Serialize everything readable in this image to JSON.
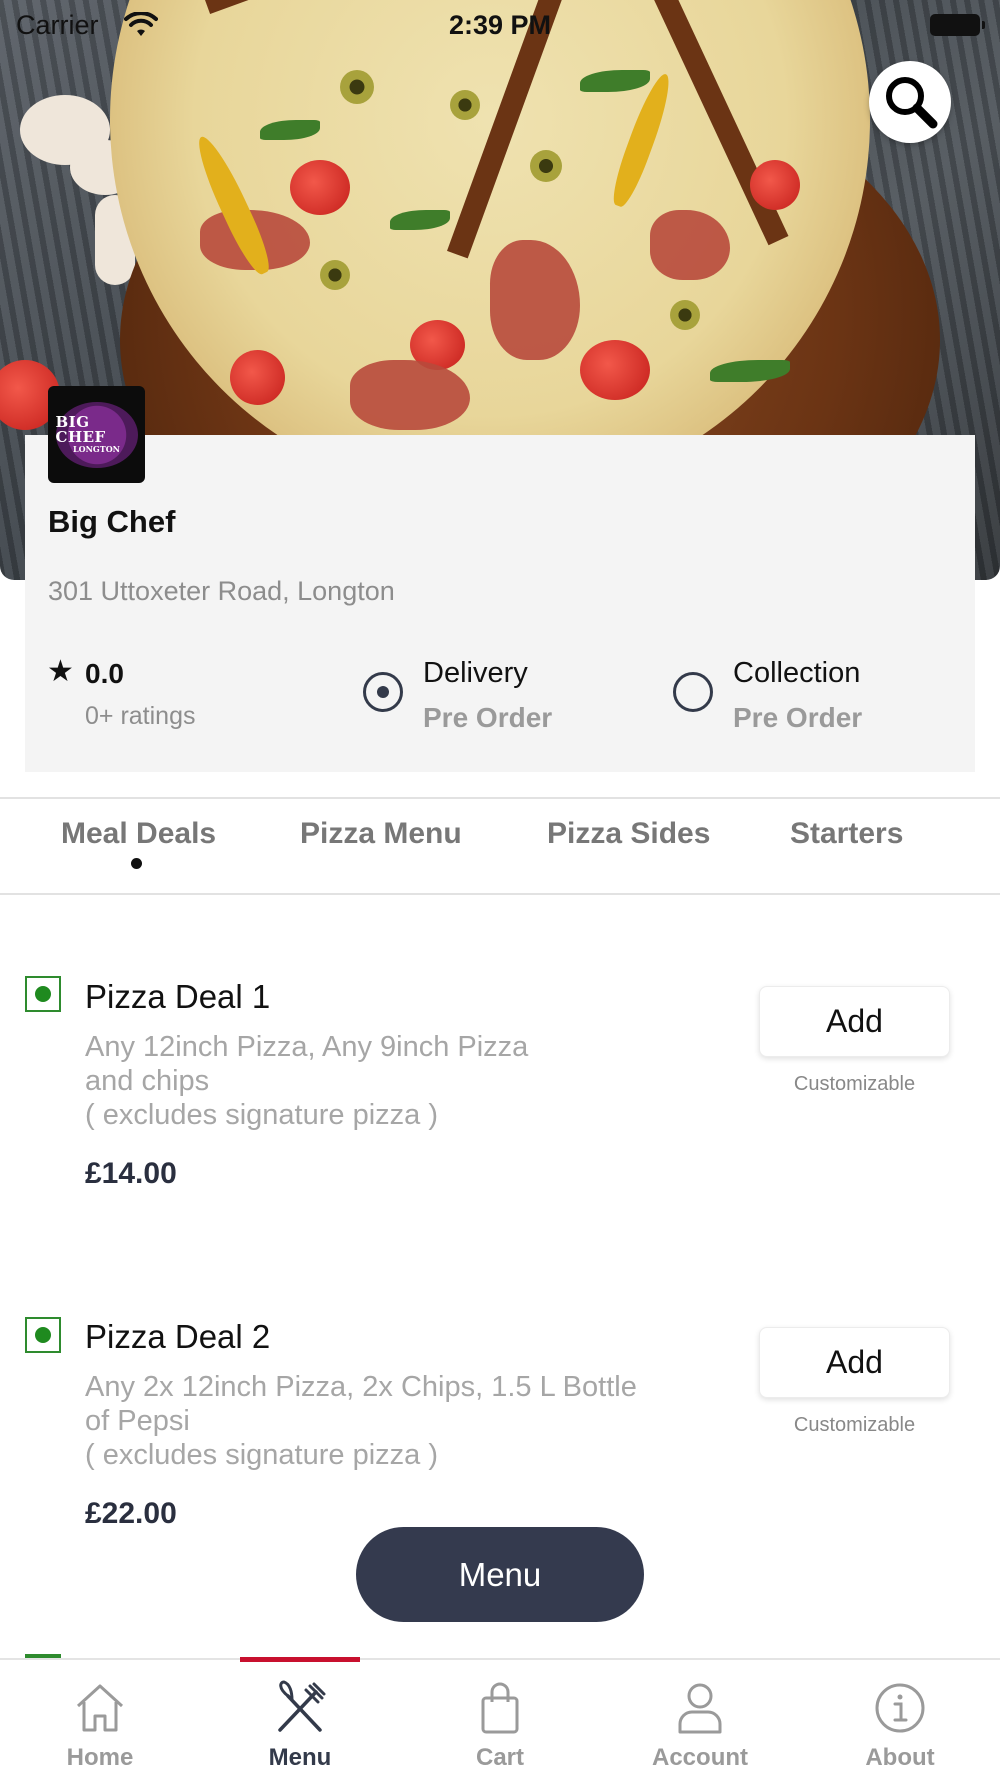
{
  "status_bar": {
    "carrier": "Carrier",
    "time": "2:39 PM"
  },
  "restaurant": {
    "logo_text_main": "BIG CHEF",
    "logo_text_sub": "LONGTON",
    "name": "Big Chef",
    "address": "301 Uttoxeter Road, Longton",
    "rating": "0.0",
    "rating_count": "0+ ratings",
    "order_options": [
      {
        "title": "Delivery",
        "subtitle": "Pre Order",
        "selected": true
      },
      {
        "title": "Collection",
        "subtitle": "Pre Order",
        "selected": false
      }
    ]
  },
  "tabs": [
    {
      "label": "Meal Deals",
      "active": true
    },
    {
      "label": "Pizza Menu",
      "active": false
    },
    {
      "label": "Pizza Sides",
      "active": false
    },
    {
      "label": "Starters",
      "active": false
    }
  ],
  "items": [
    {
      "name": "Pizza Deal 1",
      "description": "Any 12inch Pizza, Any 9inch Pizza\nand chips\n( excludes signature pizza )",
      "price": "£14.00",
      "add_label": "Add",
      "customizable": "Customizable"
    },
    {
      "name": "Pizza Deal 2",
      "description": "Any 2x 12inch Pizza, 2x Chips, 1.5 L Bottle\nof Pepsi\n( excludes signature pizza  )",
      "price": "£22.00",
      "add_label": "Add",
      "customizable": "Customizable"
    }
  ],
  "menu_button": "Menu",
  "bottom_nav": [
    {
      "label": "Home",
      "icon": "home-icon",
      "active": false
    },
    {
      "label": "Menu",
      "icon": "fork-knife-icon",
      "active": true
    },
    {
      "label": "Cart",
      "icon": "shopping-bag-icon",
      "active": false
    },
    {
      "label": "Account",
      "icon": "person-icon",
      "active": false
    },
    {
      "label": "About",
      "icon": "info-icon",
      "active": false
    }
  ],
  "colors": {
    "primary_dark": "#343a4e",
    "accent_red": "#c8102e",
    "veg_green": "#1f8a1f",
    "muted_text": "#9a9a9a",
    "card_bg": "#f4f4f4"
  }
}
